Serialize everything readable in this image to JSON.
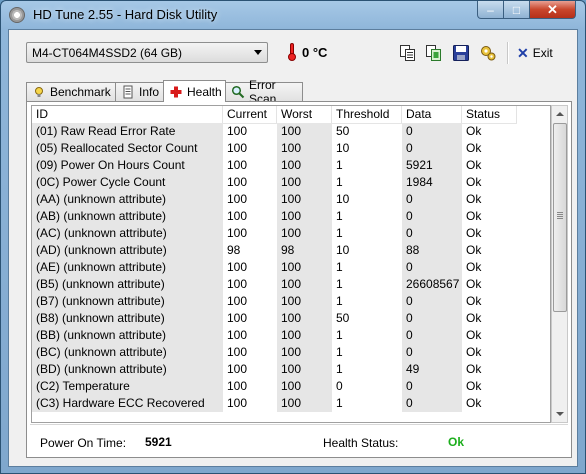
{
  "window": {
    "title": "HD Tune 2.55 - Hard Disk Utility",
    "minimize": "–",
    "maximize": "□",
    "close": "✕"
  },
  "toolbar": {
    "drive": "M4-CT064M4SSD2 (64 GB)",
    "temperature": "0 °C",
    "exit_label": "Exit",
    "icons": [
      "copy-info-icon",
      "copy-screen-icon",
      "save-icon",
      "options-icon"
    ]
  },
  "tabs": [
    {
      "label": "Benchmark",
      "icon": "benchmark-icon",
      "active": false
    },
    {
      "label": "Info",
      "icon": "info-icon",
      "active": false
    },
    {
      "label": "Health",
      "icon": "health-icon",
      "active": true
    },
    {
      "label": "Error Scan",
      "icon": "error-scan-icon",
      "active": false
    }
  ],
  "table": {
    "columns": [
      "ID",
      "Current",
      "Worst",
      "Threshold",
      "Data",
      "Status"
    ],
    "rows": [
      [
        "(01) Raw Read Error Rate",
        "100",
        "100",
        "50",
        "0",
        "Ok"
      ],
      [
        "(05) Reallocated Sector Count",
        "100",
        "100",
        "10",
        "0",
        "Ok"
      ],
      [
        "(09) Power On Hours Count",
        "100",
        "100",
        "1",
        "5921",
        "Ok"
      ],
      [
        "(0C) Power Cycle Count",
        "100",
        "100",
        "1",
        "1984",
        "Ok"
      ],
      [
        "(AA) (unknown attribute)",
        "100",
        "100",
        "10",
        "0",
        "Ok"
      ],
      [
        "(AB) (unknown attribute)",
        "100",
        "100",
        "1",
        "0",
        "Ok"
      ],
      [
        "(AC) (unknown attribute)",
        "100",
        "100",
        "1",
        "0",
        "Ok"
      ],
      [
        "(AD) (unknown attribute)",
        "98",
        "98",
        "10",
        "88",
        "Ok"
      ],
      [
        "(AE) (unknown attribute)",
        "100",
        "100",
        "1",
        "0",
        "Ok"
      ],
      [
        "(B5) (unknown attribute)",
        "100",
        "100",
        "1",
        "26608567",
        "Ok"
      ],
      [
        "(B7) (unknown attribute)",
        "100",
        "100",
        "1",
        "0",
        "Ok"
      ],
      [
        "(B8) (unknown attribute)",
        "100",
        "100",
        "50",
        "0",
        "Ok"
      ],
      [
        "(BB) (unknown attribute)",
        "100",
        "100",
        "1",
        "0",
        "Ok"
      ],
      [
        "(BC) (unknown attribute)",
        "100",
        "100",
        "1",
        "0",
        "Ok"
      ],
      [
        "(BD) (unknown attribute)",
        "100",
        "100",
        "1",
        "49",
        "Ok"
      ],
      [
        "(C2) Temperature",
        "100",
        "100",
        "0",
        "0",
        "Ok"
      ],
      [
        "(C3) Hardware ECC Recovered",
        "100",
        "100",
        "1",
        "0",
        "Ok"
      ]
    ]
  },
  "footer": {
    "power_on_label": "Power On Time:",
    "power_on_value": "5921",
    "health_label": "Health Status:",
    "health_value": "Ok",
    "health_color": "#1cae1c"
  }
}
